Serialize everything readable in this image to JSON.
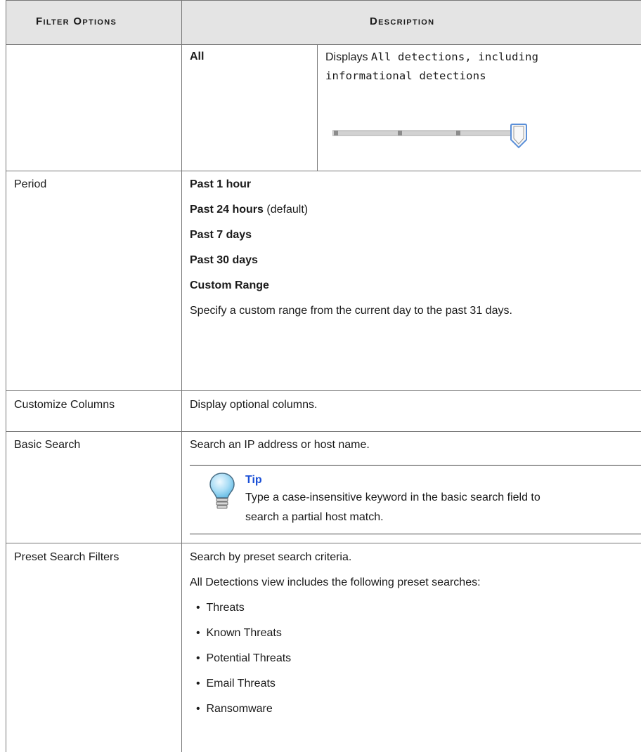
{
  "headers": {
    "filter_options": "Filter Options",
    "description": "Description"
  },
  "all_row": {
    "label": "All",
    "desc_prefix": "Displays",
    "desc_code_1": "All detections, including",
    "desc_code_2": "informational detections",
    "slider_level": 4,
    "slider_positions": 4
  },
  "period": {
    "label": "Period",
    "options": [
      "Past 1 hour",
      "Past 24 hours",
      "Past 7 days",
      "Past 30 days",
      "Custom Range"
    ],
    "default_suffix": "(default)",
    "custom_note": "Specify a custom range from the current day to the past 31 days."
  },
  "customize": {
    "label": "Customize Columns",
    "desc": "Display optional columns."
  },
  "basic_search": {
    "label": "Basic Search",
    "desc": "Search an IP address or host name.",
    "tip_title": "Tip",
    "tip_line1": "Type a case-insensitive keyword in the basic search field to",
    "tip_line2": "search a partial host match."
  },
  "preset": {
    "label": "Preset Search Filters",
    "desc": "Search by preset search criteria.",
    "intro": "All Detections view includes the following preset searches:",
    "items": [
      "Threats",
      "Known Threats",
      "Potential Threats",
      "Email Threats",
      "Ransomware"
    ]
  }
}
